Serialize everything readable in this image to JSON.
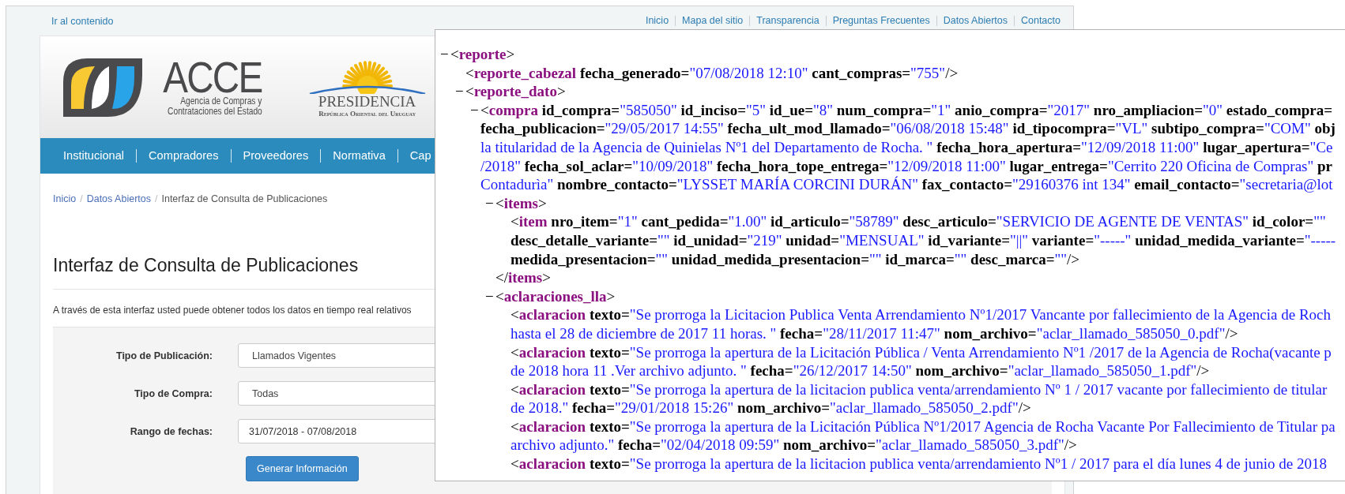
{
  "top_bar": {
    "skip_link": "Ir al contenido",
    "links": [
      "Inicio",
      "Mapa del sitio",
      "Transparencia",
      "Preguntas Frecuentes",
      "Datos Abiertos",
      "Contacto"
    ]
  },
  "header": {
    "logo": {
      "name": "ACCE",
      "subtitle_lines": [
        "Agencia de Compras y",
        "Contrataciones del Estado"
      ]
    },
    "emblem": {
      "title": "PRESIDENCIA",
      "subtitle": "República Oriental del Uruguay"
    }
  },
  "nav": [
    "Institucional",
    "Compradores",
    "Proveedores",
    "Normativa",
    "Cap"
  ],
  "breadcrumb": {
    "separator": "/",
    "items": [
      "Inicio",
      "Datos Abiertos",
      "Interfaz de Consulta de Publicaciones"
    ]
  },
  "title": "Interfaz de Consulta de Publicaciones",
  "intro": "A través de esta interfaz usted puede obtener todos los datos en tiempo real relativos",
  "form": {
    "fields": [
      {
        "label": "Tipo de Publicación:",
        "kind": "select",
        "value": "Llamados Vigentes"
      },
      {
        "label": "Tipo de Compra:",
        "kind": "select",
        "value": "Todas"
      },
      {
        "label": "Rango de fechas:",
        "kind": "date",
        "value": "31/07/2018 - 07/08/2018"
      }
    ],
    "button": "Generar Información"
  },
  "xml_viewer": {
    "nodes": [
      {
        "toggle": "−",
        "lines": [
          [
            {
              "kind": "mark",
              "text": "<"
            },
            {
              "kind": "tag",
              "text": "reporte"
            },
            {
              "kind": "mark",
              "text": ">"
            }
          ]
        ],
        "children": [
          {
            "lines": [
              [
                {
                  "kind": "mark",
                  "text": "<"
                },
                {
                  "kind": "tag",
                  "text": "reporte_cabezal"
                },
                {
                  "kind": "attr",
                  "text": " fecha_generado="
                },
                {
                  "kind": "value",
                  "text": "\"07/08/2018 12:10\""
                },
                {
                  "kind": "attr",
                  "text": " cant_compras="
                },
                {
                  "kind": "value",
                  "text": "\"755\""
                },
                {
                  "kind": "mark",
                  "text": "/>"
                }
              ]
            ]
          },
          {
            "toggle": "−",
            "lines": [
              [
                {
                  "kind": "mark",
                  "text": "<"
                },
                {
                  "kind": "tag",
                  "text": "reporte_dato"
                },
                {
                  "kind": "mark",
                  "text": ">"
                }
              ]
            ],
            "children": [
              {
                "toggle": "−",
                "lines": [
                  [
                    {
                      "kind": "mark",
                      "text": "<"
                    },
                    {
                      "kind": "tag",
                      "text": "compra"
                    },
                    {
                      "kind": "attr",
                      "text": " id_compra="
                    },
                    {
                      "kind": "value",
                      "text": "\"585050\""
                    },
                    {
                      "kind": "attr",
                      "text": " id_inciso="
                    },
                    {
                      "kind": "value",
                      "text": "\"5\""
                    },
                    {
                      "kind": "attr",
                      "text": " id_ue="
                    },
                    {
                      "kind": "value",
                      "text": "\"8\""
                    },
                    {
                      "kind": "attr",
                      "text": " num_compra="
                    },
                    {
                      "kind": "value",
                      "text": "\"1\""
                    },
                    {
                      "kind": "attr",
                      "text": " anio_compra="
                    },
                    {
                      "kind": "value",
                      "text": "\"2017\""
                    },
                    {
                      "kind": "attr",
                      "text": " nro_ampliacion="
                    },
                    {
                      "kind": "value",
                      "text": "\"0\""
                    },
                    {
                      "kind": "attr",
                      "text": " estado_compra="
                    }
                  ],
                  [
                    {
                      "kind": "attr",
                      "text": "fecha_publicacion="
                    },
                    {
                      "kind": "value",
                      "text": "\"29/05/2017 14:55\""
                    },
                    {
                      "kind": "attr",
                      "text": " fecha_ult_mod_llamado="
                    },
                    {
                      "kind": "value",
                      "text": "\"06/08/2018 15:48\""
                    },
                    {
                      "kind": "attr",
                      "text": " id_tipocompra="
                    },
                    {
                      "kind": "value",
                      "text": "\"VL\""
                    },
                    {
                      "kind": "attr",
                      "text": " subtipo_compra="
                    },
                    {
                      "kind": "value",
                      "text": "\"COM\""
                    },
                    {
                      "kind": "attr",
                      "text": " obj"
                    }
                  ],
                  [
                    {
                      "kind": "value",
                      "text": "la titularidad de la Agencia de Quinielas Nº1 del Departamento de Rocha. \""
                    },
                    {
                      "kind": "attr",
                      "text": " fecha_hora_apertura="
                    },
                    {
                      "kind": "value",
                      "text": "\"12/09/2018 11:00\""
                    },
                    {
                      "kind": "attr",
                      "text": " lugar_apertura="
                    },
                    {
                      "kind": "value",
                      "text": "\"Ce"
                    }
                  ],
                  [
                    {
                      "kind": "value",
                      "text": "/2018\""
                    },
                    {
                      "kind": "attr",
                      "text": " fecha_sol_aclar="
                    },
                    {
                      "kind": "value",
                      "text": "\"10/09/2018\""
                    },
                    {
                      "kind": "attr",
                      "text": " fecha_hora_tope_entrega="
                    },
                    {
                      "kind": "value",
                      "text": "\"12/09/2018 11:00\""
                    },
                    {
                      "kind": "attr",
                      "text": " lugar_entrega="
                    },
                    {
                      "kind": "value",
                      "text": "\"Cerrito 220 Oficina de Compras\""
                    },
                    {
                      "kind": "attr",
                      "text": " pr"
                    }
                  ],
                  [
                    {
                      "kind": "value",
                      "text": "Contadurìa\""
                    },
                    {
                      "kind": "attr",
                      "text": " nombre_contacto="
                    },
                    {
                      "kind": "value",
                      "text": "\"LYSSET MARÍA CORCINI DURÁN\""
                    },
                    {
                      "kind": "attr",
                      "text": " fax_contacto="
                    },
                    {
                      "kind": "value",
                      "text": "\"29160376 int 134\""
                    },
                    {
                      "kind": "attr",
                      "text": " email_contacto="
                    },
                    {
                      "kind": "value",
                      "text": "\"secretaria@lot"
                    }
                  ]
                ],
                "children": [
                  {
                    "toggle": "−",
                    "lines": [
                      [
                        {
                          "kind": "mark",
                          "text": "<"
                        },
                        {
                          "kind": "tag",
                          "text": "items"
                        },
                        {
                          "kind": "mark",
                          "text": ">"
                        }
                      ]
                    ],
                    "children": [
                      {
                        "lines": [
                          [
                            {
                              "kind": "mark",
                              "text": "<"
                            },
                            {
                              "kind": "tag",
                              "text": "item"
                            },
                            {
                              "kind": "attr",
                              "text": " nro_item="
                            },
                            {
                              "kind": "value",
                              "text": "\"1\""
                            },
                            {
                              "kind": "attr",
                              "text": " cant_pedida="
                            },
                            {
                              "kind": "value",
                              "text": "\"1.00\""
                            },
                            {
                              "kind": "attr",
                              "text": " id_articulo="
                            },
                            {
                              "kind": "value",
                              "text": "\"58789\""
                            },
                            {
                              "kind": "attr",
                              "text": " desc_articulo="
                            },
                            {
                              "kind": "value",
                              "text": "\"SERVICIO DE AGENTE DE VENTAS\""
                            },
                            {
                              "kind": "attr",
                              "text": " id_color="
                            },
                            {
                              "kind": "value",
                              "text": "\"\""
                            }
                          ],
                          [
                            {
                              "kind": "attr",
                              "text": "desc_detalle_variante="
                            },
                            {
                              "kind": "value",
                              "text": "\"\""
                            },
                            {
                              "kind": "attr",
                              "text": " id_unidad="
                            },
                            {
                              "kind": "value",
                              "text": "\"219\""
                            },
                            {
                              "kind": "attr",
                              "text": " unidad="
                            },
                            {
                              "kind": "value",
                              "text": "\"MENSUAL\""
                            },
                            {
                              "kind": "attr",
                              "text": " id_variante="
                            },
                            {
                              "kind": "value",
                              "text": "\"||\""
                            },
                            {
                              "kind": "attr",
                              "text": " variante="
                            },
                            {
                              "kind": "value",
                              "text": "\"-----\""
                            },
                            {
                              "kind": "attr",
                              "text": " unidad_medida_variante="
                            },
                            {
                              "kind": "value",
                              "text": "\"-----"
                            }
                          ],
                          [
                            {
                              "kind": "attr",
                              "text": "medida_presentacion="
                            },
                            {
                              "kind": "value",
                              "text": "\"\""
                            },
                            {
                              "kind": "attr",
                              "text": " unidad_medida_presentacion="
                            },
                            {
                              "kind": "value",
                              "text": "\"\""
                            },
                            {
                              "kind": "attr",
                              "text": " id_marca="
                            },
                            {
                              "kind": "value",
                              "text": "\"\""
                            },
                            {
                              "kind": "attr",
                              "text": " desc_marca="
                            },
                            {
                              "kind": "value",
                              "text": "\"\""
                            },
                            {
                              "kind": "mark",
                              "text": "/>"
                            }
                          ]
                        ]
                      }
                    ],
                    "close": [
                      {
                        "kind": "mark",
                        "text": "</"
                      },
                      {
                        "kind": "tag",
                        "text": "items"
                      },
                      {
                        "kind": "mark",
                        "text": ">"
                      }
                    ]
                  },
                  {
                    "toggle": "−",
                    "lines": [
                      [
                        {
                          "kind": "mark",
                          "text": "<"
                        },
                        {
                          "kind": "tag",
                          "text": "aclaraciones_lla"
                        },
                        {
                          "kind": "mark",
                          "text": ">"
                        }
                      ]
                    ],
                    "children": [
                      {
                        "lines": [
                          [
                            {
                              "kind": "mark",
                              "text": "<"
                            },
                            {
                              "kind": "tag",
                              "text": "aclaracion"
                            },
                            {
                              "kind": "attr",
                              "text": " texto="
                            },
                            {
                              "kind": "value",
                              "text": "\"Se prorroga la Licitacion Publica Venta Arrendamiento Nº1/2017 Vancante por fallecimiento de la Agencia de Roch"
                            }
                          ],
                          [
                            {
                              "kind": "value",
                              "text": "hasta el 28 de diciembre de 2017 11 horas. \""
                            },
                            {
                              "kind": "attr",
                              "text": " fecha="
                            },
                            {
                              "kind": "value",
                              "text": "\"28/11/2017 11:47\""
                            },
                            {
                              "kind": "attr",
                              "text": " nom_archivo="
                            },
                            {
                              "kind": "value",
                              "text": "\"aclar_llamado_585050_0.pdf\""
                            },
                            {
                              "kind": "mark",
                              "text": "/>"
                            }
                          ]
                        ]
                      },
                      {
                        "lines": [
                          [
                            {
                              "kind": "mark",
                              "text": "<"
                            },
                            {
                              "kind": "tag",
                              "text": "aclaracion"
                            },
                            {
                              "kind": "attr",
                              "text": " texto="
                            },
                            {
                              "kind": "value",
                              "text": "\"Se prorroga la apertura de la Licitación Pública / Venta Arrendamiento Nº1 /2017 de la Agencia de Rocha(vacante p"
                            }
                          ],
                          [
                            {
                              "kind": "value",
                              "text": "de 2018 hora 11 .Ver archivo adjunto. \""
                            },
                            {
                              "kind": "attr",
                              "text": " fecha="
                            },
                            {
                              "kind": "value",
                              "text": "\"26/12/2017 14:50\""
                            },
                            {
                              "kind": "attr",
                              "text": " nom_archivo="
                            },
                            {
                              "kind": "value",
                              "text": "\"aclar_llamado_585050_1.pdf\""
                            },
                            {
                              "kind": "mark",
                              "text": "/>"
                            }
                          ]
                        ]
                      },
                      {
                        "lines": [
                          [
                            {
                              "kind": "mark",
                              "text": "<"
                            },
                            {
                              "kind": "tag",
                              "text": "aclaracion"
                            },
                            {
                              "kind": "attr",
                              "text": " texto="
                            },
                            {
                              "kind": "value",
                              "text": "\"Se prorroga la apertura de la licitacion publica venta/arrendamiento Nº 1 / 2017 vacante por fallecimiento de titular"
                            }
                          ],
                          [
                            {
                              "kind": "value",
                              "text": "de 2018.\""
                            },
                            {
                              "kind": "attr",
                              "text": " fecha="
                            },
                            {
                              "kind": "value",
                              "text": "\"29/01/2018 15:26\""
                            },
                            {
                              "kind": "attr",
                              "text": " nom_archivo="
                            },
                            {
                              "kind": "value",
                              "text": "\"aclar_llamado_585050_2.pdf\""
                            },
                            {
                              "kind": "mark",
                              "text": "/>"
                            }
                          ]
                        ]
                      },
                      {
                        "lines": [
                          [
                            {
                              "kind": "mark",
                              "text": "<"
                            },
                            {
                              "kind": "tag",
                              "text": "aclaracion"
                            },
                            {
                              "kind": "attr",
                              "text": " texto="
                            },
                            {
                              "kind": "value",
                              "text": "\"Se prorroga la apertura de la Licitación Pública Nº1/2017 Agencia de Rocha Vacante Por Fallecimiento de Titular pa"
                            }
                          ],
                          [
                            {
                              "kind": "value",
                              "text": "archivo adjunto.\""
                            },
                            {
                              "kind": "attr",
                              "text": " fecha="
                            },
                            {
                              "kind": "value",
                              "text": "\"02/04/2018 09:59\""
                            },
                            {
                              "kind": "attr",
                              "text": " nom_archivo="
                            },
                            {
                              "kind": "value",
                              "text": "\"aclar_llamado_585050_3.pdf\""
                            },
                            {
                              "kind": "mark",
                              "text": "/>"
                            }
                          ]
                        ]
                      },
                      {
                        "lines": [
                          [
                            {
                              "kind": "mark",
                              "text": "<"
                            },
                            {
                              "kind": "tag",
                              "text": "aclaracion"
                            },
                            {
                              "kind": "attr",
                              "text": " texto="
                            },
                            {
                              "kind": "value",
                              "text": "\"Se prorroga la apertura de la licitacion publica venta/arrendamiento Nº1 / 2017 para el día lunes 4 de junio de 2018"
                            }
                          ]
                        ]
                      }
                    ]
                  }
                ]
              }
            ]
          }
        ]
      }
    ]
  }
}
